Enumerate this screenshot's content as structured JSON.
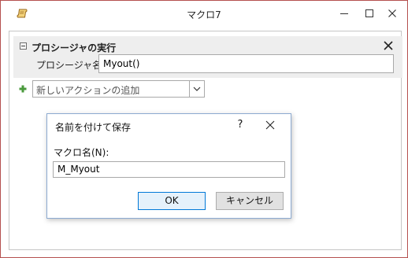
{
  "window": {
    "title": "マクロ7",
    "icon": "macro-scroll-icon",
    "border_color": "#b5514f"
  },
  "action": {
    "title": "プロシージャの実行",
    "argument_label": "プロシージャ名",
    "argument_value": "Myout()"
  },
  "add_action": {
    "placeholder": "新しいアクションの追加"
  },
  "dialog": {
    "title": "名前を付けて保存",
    "help": "?",
    "field_label": "マクロ名(N):",
    "field_value": "M_Myout",
    "ok_label": "OK",
    "cancel_label": "キャンセル",
    "accent": "#0078d7"
  }
}
